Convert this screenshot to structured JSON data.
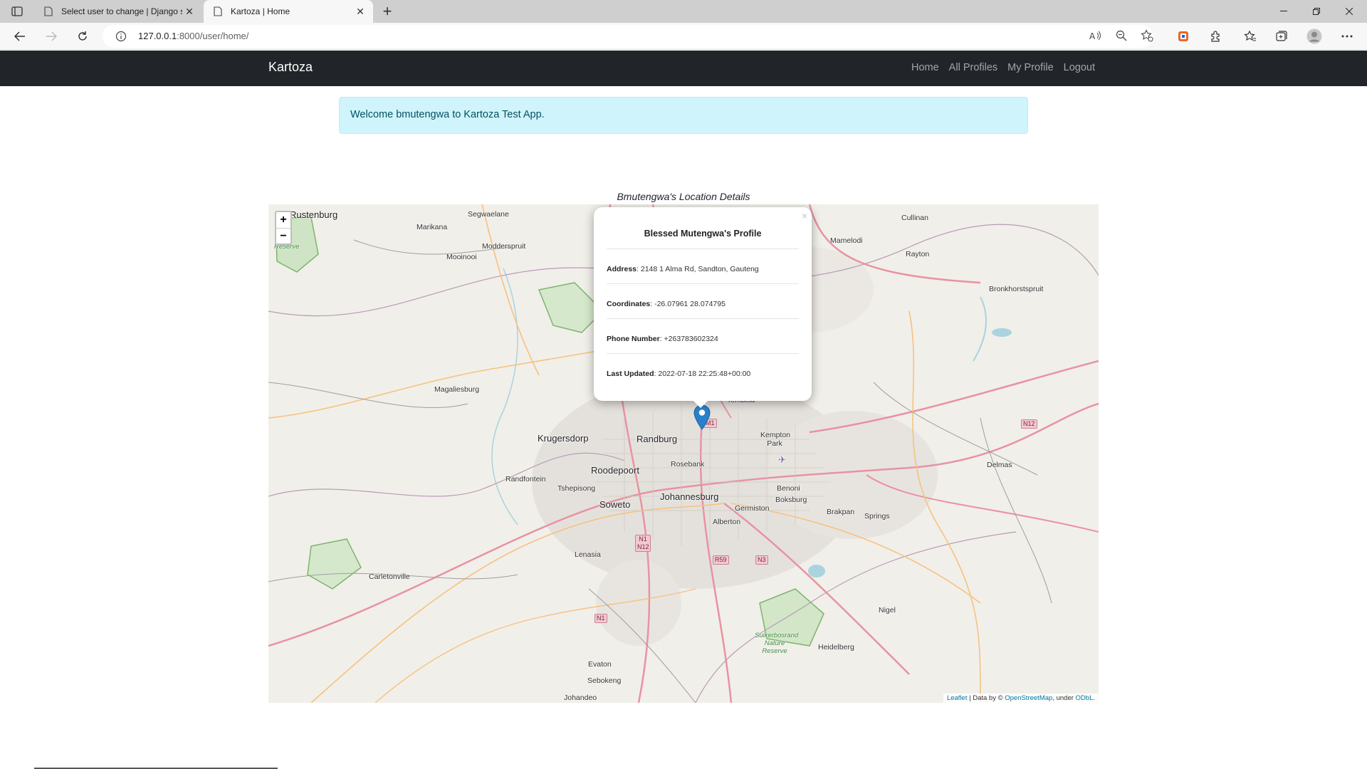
{
  "browser": {
    "tabs": [
      {
        "title": "Select user to change | Django s",
        "active": false
      },
      {
        "title": "Kartoza | Home",
        "active": true
      }
    ],
    "url_host": "127.0.0.1",
    "url_path": ":8000/user/home/"
  },
  "navbar": {
    "brand": "Kartoza",
    "links": [
      "Home",
      "All Profiles",
      "My Profile",
      "Logout"
    ]
  },
  "alert": {
    "message": "Welcome bmutengwa to Kartoza Test App."
  },
  "map": {
    "caption": "Bmutengwa's Location Details",
    "zoom_in": "+",
    "zoom_out": "−",
    "popup": {
      "close": "×",
      "title": "Blessed Mutengwa's Profile",
      "address_label": "Address",
      "address_value": ": 2148 1 Alma Rd, Sandton, Gauteng",
      "coordinates_label": "Coordinates",
      "coordinates_value": ": -26.07961 28.074795",
      "phone_label": "Phone Number",
      "phone_value": ": +263783602324",
      "updated_label": "Last Updated",
      "updated_value": ": 2022-07-18 22:25:48+00:00"
    },
    "places": {
      "rustenburg": "Rustenburg",
      "segwaelane": "Segwaelane",
      "marikana": "Marikana",
      "modderspruit": "Modderspruit",
      "mooinooi": "Mooinooi",
      "cullinan": "Cullinan",
      "mamelodi": "Mamelodi",
      "rayton": "Rayton",
      "bronkhorstspruit": "Bronkhorstspruit",
      "magaliesburg": "Magaliesburg",
      "krugersdorp": "Krugersdorp",
      "randburg": "Randburg",
      "kempton_park": "Kempton Park",
      "randfontein": "Randfontein",
      "roodepoort": "Roodepoort",
      "rosebank": "Rosebank",
      "tshepisong": "Tshepisong",
      "soweto": "Soweto",
      "johannesburg": "Johannesburg",
      "germiston": "Germiston",
      "boksburg": "Boksburg",
      "benoni": "Benoni",
      "brakpan": "Brakpan",
      "springs": "Springs",
      "delmas": "Delmas",
      "alberton": "Alberton",
      "lenasia": "Lenasia",
      "carletonville": "Carletonville",
      "nigel": "Nigel",
      "heidelberg": "Heidelberg",
      "evaton": "Evaton",
      "sebokeng": "Sebokeng",
      "johandeo": "Johandeo",
      "suikerbosrand": "Suikerbosrand Nature Reserve",
      "tembisa": "Tembisa",
      "reserve_nw": "Reserve"
    },
    "shields": {
      "n12_east": "N12",
      "n1_n12": "N1 N12",
      "r59": "R59",
      "n3": "N3",
      "n1_south": "N1",
      "m1": "M1"
    },
    "attribution": {
      "leaflet": "Leaflet",
      "text1": " | Data by © ",
      "osm": "OpenStreetMap",
      "text2": ", under ",
      "odbl": "ODbL."
    }
  }
}
